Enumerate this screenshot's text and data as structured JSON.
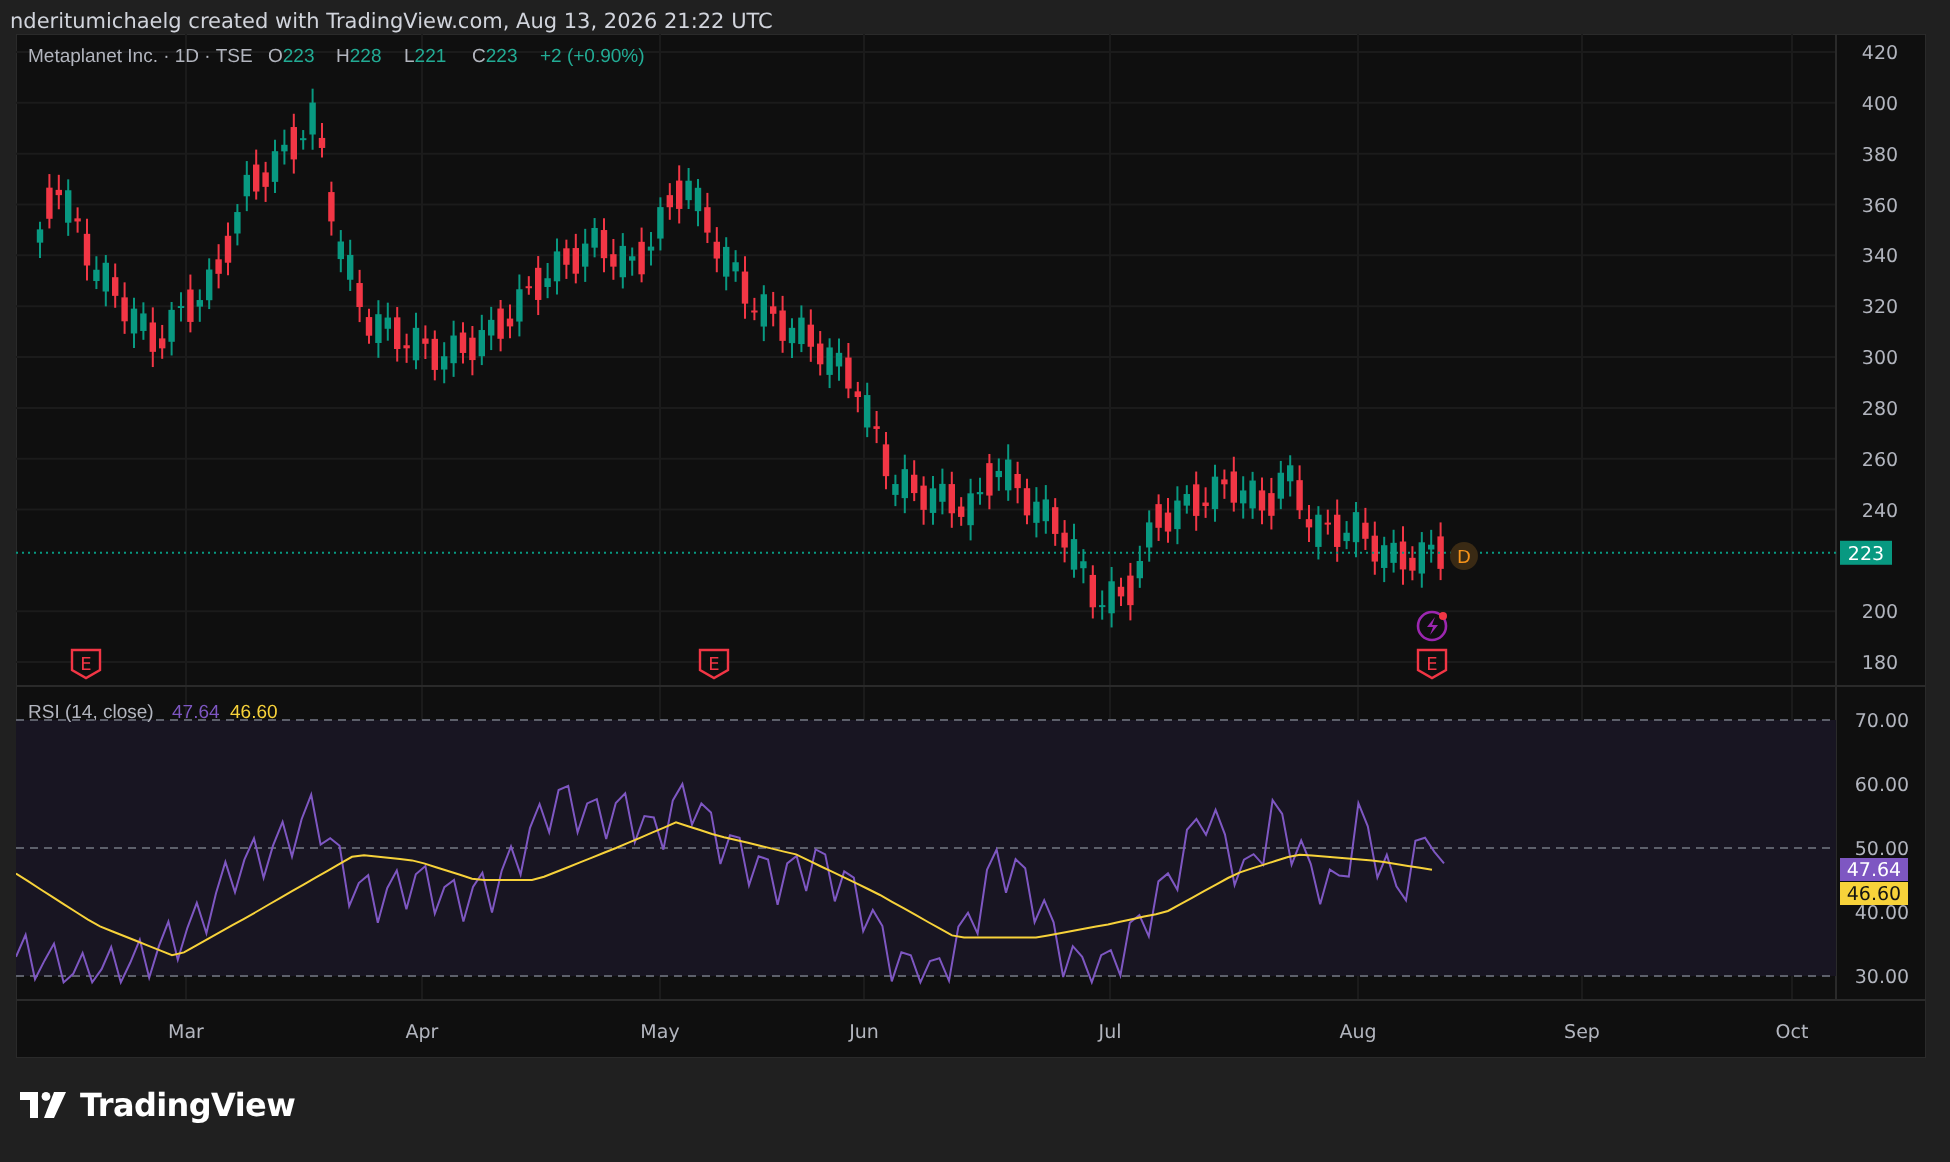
{
  "caption": "nderitumichaelg created with TradingView.com, Aug 13, 2026 21:22 UTC",
  "legend": {
    "title": "Metaplanet Inc. · 1D · TSE",
    "ohlc": [
      {
        "label": "O",
        "value": "223"
      },
      {
        "label": "H",
        "value": "228"
      },
      {
        "label": "L",
        "value": "221"
      },
      {
        "label": "C",
        "value": "223"
      }
    ],
    "change": "+2 (+0.90%)"
  },
  "price_axis": {
    "ticks": [
      "420",
      "400",
      "380",
      "360",
      "340",
      "320",
      "300",
      "280",
      "260",
      "240",
      "200",
      "180"
    ],
    "last_price": "223"
  },
  "events": [
    {
      "kind": "earnings",
      "label": "E"
    },
    {
      "kind": "earnings",
      "label": "E"
    },
    {
      "kind": "earnings",
      "label": "E"
    },
    {
      "kind": "dividend",
      "label": "D"
    },
    {
      "kind": "split"
    }
  ],
  "rsi": {
    "title": "RSI (14, close)",
    "value": "47.64",
    "ma_value": "46.60",
    "ticks": [
      "70.00",
      "60.00",
      "50.00",
      "40.00",
      "30.00"
    ],
    "value_badge": "47.64",
    "ma_badge": "46.60"
  },
  "time_axis": [
    "Mar",
    "Apr",
    "May",
    "Jun",
    "Jul",
    "Aug",
    "Sep",
    "Oct"
  ],
  "footer": {
    "logo_text": "TradingView"
  }
}
